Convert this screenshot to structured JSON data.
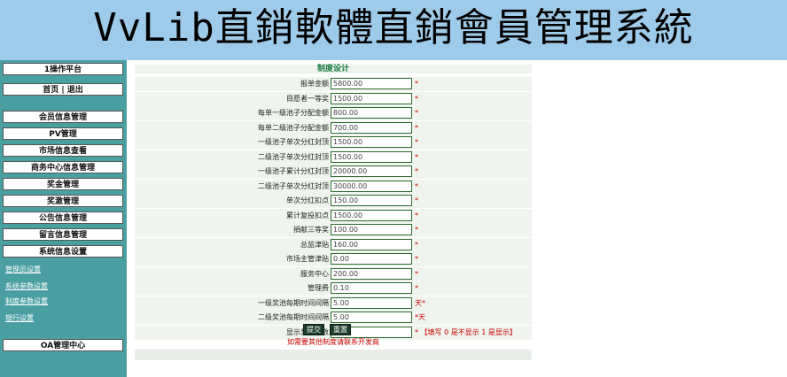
{
  "header": {
    "title": "VvLib直銷軟體直銷會員管理系統"
  },
  "sidebar": {
    "platform": "1操作平台",
    "home_logout": "首页 | 退出",
    "menu": [
      "会员信息管理",
      "PV管理",
      "市场信息查看",
      "商务中心信息管理",
      "奖金管理",
      "奖激管理",
      "公告信息管理",
      "留言信息管理",
      "系统信息设置"
    ],
    "submenu": [
      "管理员设置",
      "系统参数设置",
      "制度参数设置",
      "银行设置"
    ],
    "oa": "OA管理中心"
  },
  "form": {
    "title": "制度设计",
    "rows": [
      {
        "label": "报单金额",
        "value": "5800.00",
        "note": "*"
      },
      {
        "label": "目愿者一等奖",
        "value": "1500.00",
        "note": "*"
      },
      {
        "label": "每单一级池子分配金额",
        "value": "800.00",
        "note": "*"
      },
      {
        "label": "每单二级池子分配金额",
        "value": "700.00",
        "note": "*"
      },
      {
        "label": "一级池子单次分红封顶",
        "value": "1500.00",
        "note": "*"
      },
      {
        "label": "二级池子单次分红封顶",
        "value": "1500.00",
        "note": "*"
      },
      {
        "label": "一级池子累计分红封顶",
        "value": "20000.00",
        "note": "*"
      },
      {
        "label": "二级池子单次分红封顶",
        "value": "30000.00",
        "note": "*"
      },
      {
        "label": "单次分红扣点",
        "value": "150.00",
        "note": "*"
      },
      {
        "label": "累计复投扣点",
        "value": "1500.00",
        "note": "*"
      },
      {
        "label": "捐献三等奖",
        "value": "100.00",
        "note": "*"
      },
      {
        "label": "总监津贴",
        "value": "160.00",
        "note": "*"
      },
      {
        "label": "市场主管津贴",
        "value": "0.00",
        "note": "*"
      },
      {
        "label": "服务中心",
        "value": "200.00",
        "note": "*"
      },
      {
        "label": "管理费",
        "value": "0.10",
        "note": "*"
      },
      {
        "label": "一级奖池每期时间间隔",
        "value": "5.00",
        "note": "天*"
      },
      {
        "label": "二级奖池每期时间间隔",
        "value": "5.00",
        "note": "*天"
      },
      {
        "label": "显示奖池系数",
        "value": "1.00",
        "note": "* 【填写 0 是不显示 1 是显示】"
      }
    ],
    "submit_label": "提交",
    "reset_label": "重置",
    "footer_note": "如需要其他制度请联系开发商"
  }
}
